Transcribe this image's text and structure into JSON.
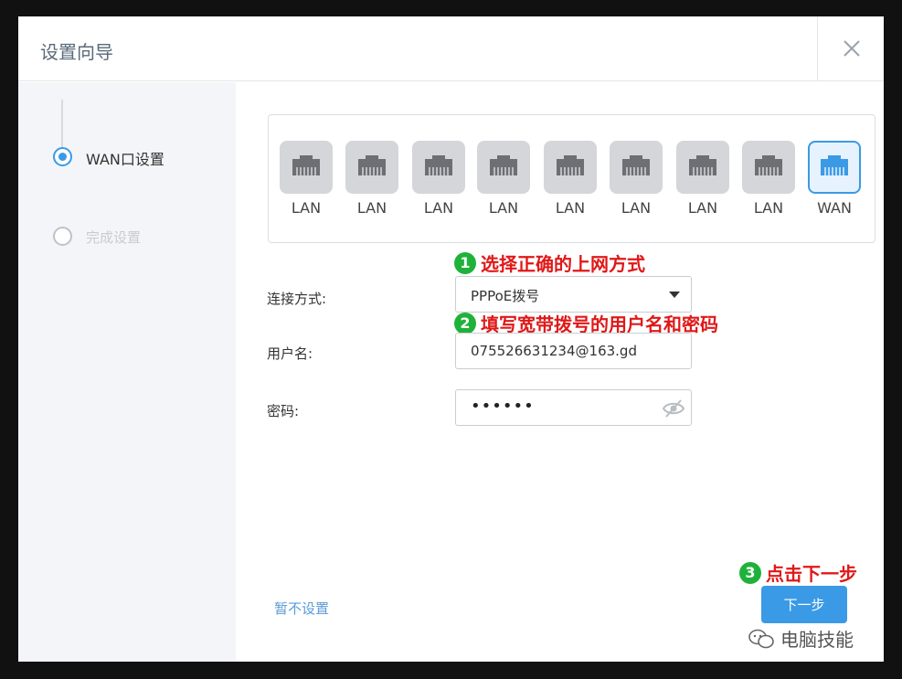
{
  "dialog": {
    "title": "设置向导",
    "close_icon": "close-icon"
  },
  "sidebar": {
    "steps": [
      {
        "label": "WAN口设置",
        "state": "active"
      },
      {
        "label": "完成设置",
        "state": "inactive"
      }
    ]
  },
  "ports": [
    {
      "label": "LAN",
      "type": "lan"
    },
    {
      "label": "LAN",
      "type": "lan"
    },
    {
      "label": "LAN",
      "type": "lan"
    },
    {
      "label": "LAN",
      "type": "lan"
    },
    {
      "label": "LAN",
      "type": "lan"
    },
    {
      "label": "LAN",
      "type": "lan"
    },
    {
      "label": "LAN",
      "type": "lan"
    },
    {
      "label": "LAN",
      "type": "lan"
    },
    {
      "label": "WAN",
      "type": "wan",
      "selected": true
    }
  ],
  "annotations": [
    {
      "num": "1",
      "text": "选择正确的上网方式"
    },
    {
      "num": "2",
      "text": "填写宽带拨号的用户名和密码"
    },
    {
      "num": "3",
      "text": "点击下一步"
    }
  ],
  "form": {
    "connection_label": "连接方式:",
    "connection_value": "PPPoE拨号",
    "username_label": "用户名:",
    "username_value": "075526631234@163.gd",
    "password_label": "密码:",
    "password_value": "••••••"
  },
  "footer": {
    "skip_label": "暂不设置",
    "next_label": "下一步"
  },
  "watermark": {
    "text": "电脑技能"
  },
  "colors": {
    "accent": "#3a9ae6",
    "annotation_red": "#e01818",
    "annotation_green": "#1fb23a"
  }
}
